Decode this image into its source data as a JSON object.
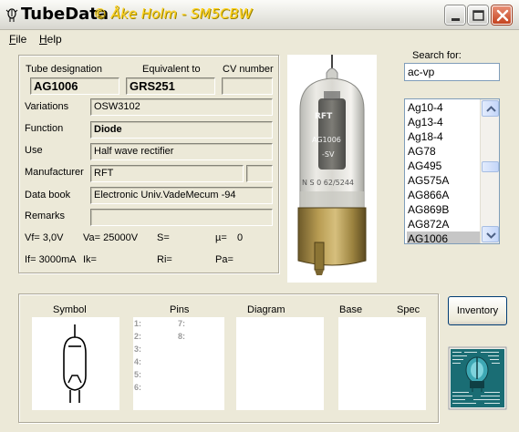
{
  "window": {
    "title": "TubeData",
    "credit": "© Åke Holm - SM5CBW"
  },
  "menu": [
    {
      "label": "File",
      "accel": "F",
      "rest": "ile"
    },
    {
      "label": "Help",
      "accel": "H",
      "rest": "elp"
    }
  ],
  "details": {
    "tube_designation_label": "Tube designation",
    "tube_designation": "AG1006",
    "equivalent_label": "Equivalent to",
    "equivalent": "GRS251",
    "cv_label": "CV number",
    "cv": "",
    "variations_label": "Variations",
    "variations": "OSW3102",
    "function_label": "Function",
    "function": "Diode",
    "use_label": "Use",
    "use": "Half wave rectifier",
    "manufacturer_label": "Manufacturer",
    "manufacturer": "RFT",
    "manufacturer_extra": "",
    "databook_label": "Data book",
    "databook": "Electronic Univ.VadeMecum -94",
    "remarks_label": "Remarks",
    "remarks": ""
  },
  "params": {
    "vf": "Vf= 3,0V",
    "va": "Va= 25000V",
    "s": "S=",
    "mu": "µ=",
    "mu_val": "0",
    "if": "If= 3000mA",
    "ik": "Ik=",
    "ri": "Ri=",
    "pa": "Pa="
  },
  "search": {
    "label": "Search for:",
    "value": "ac-vp"
  },
  "tube_list": {
    "items": [
      "Ag10-4",
      "Ag13-4",
      "Ag18-4",
      "AG78",
      "AG495",
      "AG575A",
      "AG866A",
      "AG869B",
      "AG872A",
      "AG1006"
    ],
    "selected": "AG1006",
    "scroll_position": 0.45
  },
  "bottom": {
    "symbol_label": "Symbol",
    "pins_label": "Pins",
    "diagram_label": "Diagram",
    "base_label": "Base",
    "spec_label": "Spec",
    "pins_left": [
      "1:",
      "2:",
      "3:",
      "4:",
      "5:",
      "6:"
    ],
    "pins_right": [
      "7:",
      "8:"
    ]
  },
  "buttons": {
    "inventory": "Inventory"
  }
}
